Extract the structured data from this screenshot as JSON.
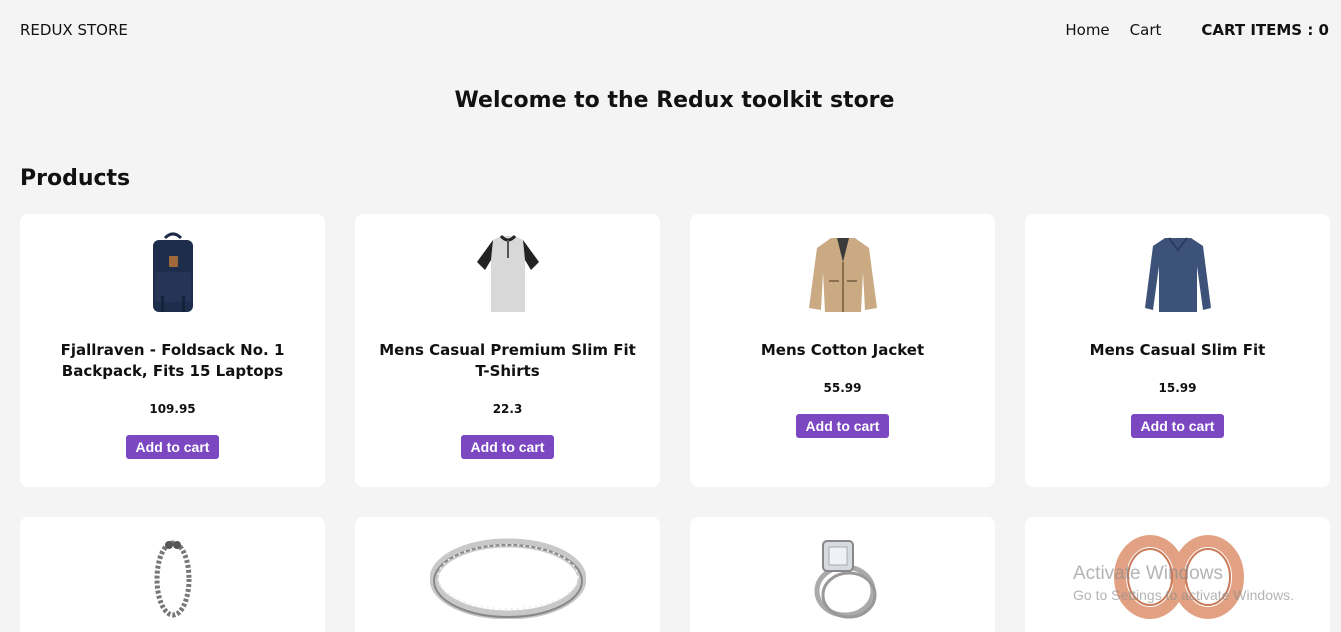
{
  "nav": {
    "brand": "REDUX STORE",
    "links": [
      {
        "label": "Home"
      },
      {
        "label": "Cart"
      }
    ],
    "cart_items_text": "CART ITEMS : 0"
  },
  "welcome": "Welcome to the Redux toolkit store",
  "products_heading": "Products",
  "products": [
    {
      "title": "Fjallraven - Foldsack No. 1 Backpack, Fits 15 Laptops",
      "price": "109.95",
      "button": "Add to cart",
      "icon": "backpack-icon"
    },
    {
      "title": "Mens Casual Premium Slim Fit T-Shirts",
      "price": "22.3",
      "button": "Add to cart",
      "icon": "tshirt-icon"
    },
    {
      "title": "Mens Cotton Jacket",
      "price": "55.99",
      "button": "Add to cart",
      "icon": "jacket-icon"
    },
    {
      "title": "Mens Casual Slim Fit",
      "price": "15.99",
      "button": "Add to cart",
      "icon": "longsleeve-icon"
    }
  ],
  "partial_products": [
    {
      "icon": "bracelet-icon"
    },
    {
      "icon": "silver-ring-icon"
    },
    {
      "icon": "diamond-ring-icon"
    },
    {
      "icon": "rose-gold-rings-icon"
    }
  ],
  "watermark": {
    "line1": "Activate Windows",
    "line2": "Go to Settings to activate Windows."
  },
  "colors": {
    "button": "#7b48c2",
    "background": "#f4f4f4",
    "card": "#ffffff"
  }
}
